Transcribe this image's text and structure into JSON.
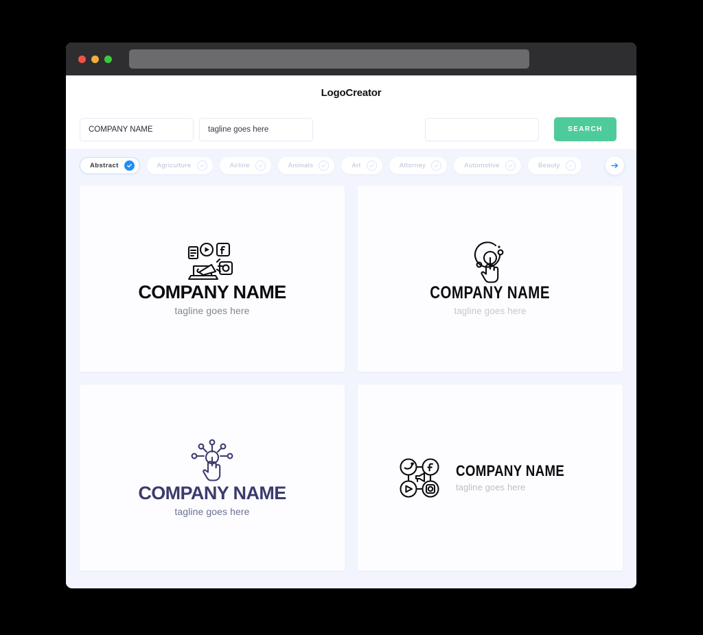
{
  "window": {
    "traffic_lights": [
      "close",
      "minimize",
      "maximize"
    ],
    "url_value": ""
  },
  "header": {
    "title": "LogoCreator"
  },
  "search": {
    "company_value": "COMPANY NAME",
    "company_placeholder": "COMPANY NAME",
    "tagline_value": "tagline goes here",
    "tagline_placeholder": "tagline goes here",
    "third_value": "",
    "third_placeholder": "",
    "button_label": "SEARCH",
    "button_color": "#4ecb9b"
  },
  "categories": {
    "next_icon": "arrow-right-icon",
    "accent_color": "#1f8ff5",
    "items": [
      {
        "label": "Abstract",
        "selected": true
      },
      {
        "label": "Agriculture",
        "selected": false
      },
      {
        "label": "Airline",
        "selected": false
      },
      {
        "label": "Animals",
        "selected": false
      },
      {
        "label": "Art",
        "selected": false
      },
      {
        "label": "Attorney",
        "selected": false
      },
      {
        "label": "Automotive",
        "selected": false
      },
      {
        "label": "Beauty",
        "selected": false
      }
    ]
  },
  "results": {
    "cards": [
      {
        "icon": "laptop-megaphone-social-icon",
        "name": "COMPANY NAME",
        "tagline": "tagline goes here",
        "name_color": "#0b0b0d"
      },
      {
        "icon": "hand-touch-signal-icon",
        "name": "COMPANY NAME",
        "tagline": "tagline goes here",
        "name_color": "#0b0b0d"
      },
      {
        "icon": "hand-network-nodes-icon",
        "name": "COMPANY NAME",
        "tagline": "tagline goes here",
        "name_color": "#3b3b6d"
      },
      {
        "icon": "social-network-megaphone-icon",
        "name": "COMPANY NAME",
        "tagline": "tagline goes here",
        "name_color": "#0b0b0d"
      }
    ]
  }
}
